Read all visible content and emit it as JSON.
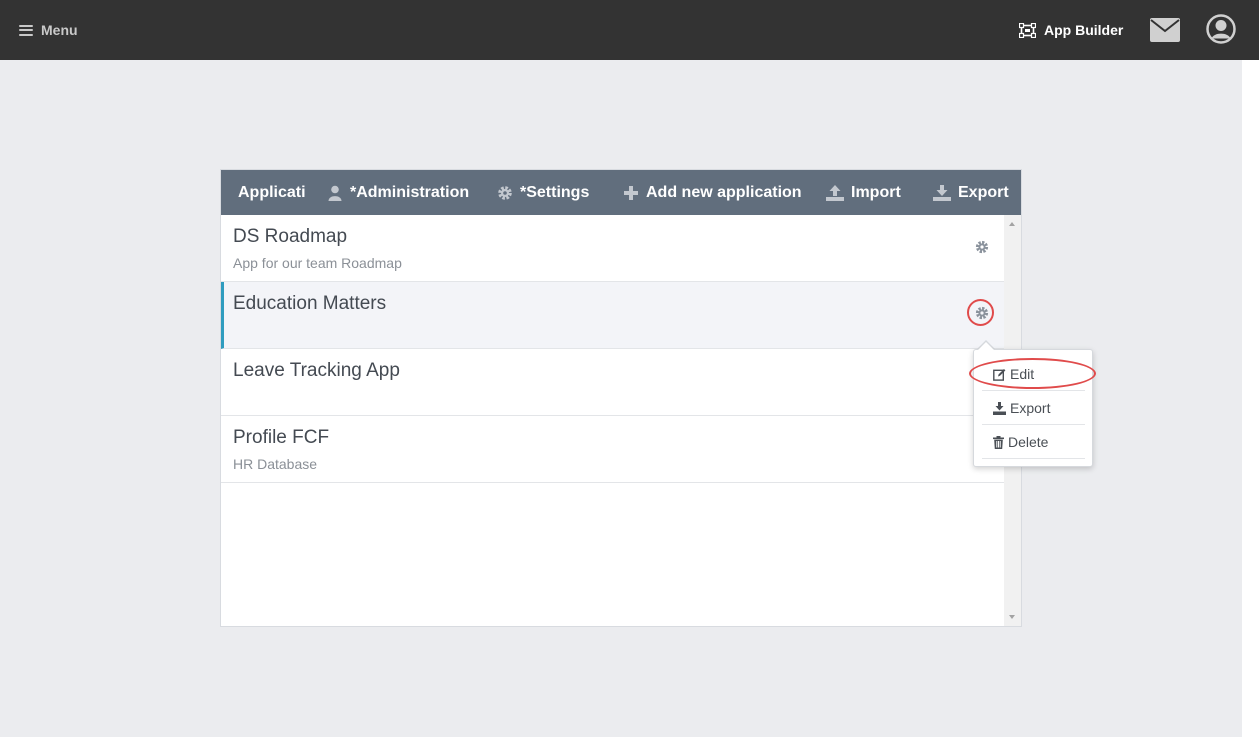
{
  "topbar": {
    "menu_label": "Menu",
    "app_builder_label": "App Builder",
    "icons": {
      "menu": "hamburger-icon",
      "app_builder": "app-builder-icon",
      "mail": "envelope-icon",
      "user": "user-circle-icon"
    }
  },
  "panel": {
    "title": "Applications",
    "actions": [
      {
        "label": "*Administration",
        "icon": "user-icon"
      },
      {
        "label": "*Settings",
        "icon": "gear-icon"
      },
      {
        "label": "Add new application",
        "icon": "plus-icon"
      },
      {
        "label": "Import",
        "icon": "upload-icon"
      },
      {
        "label": "Export",
        "icon": "download-icon"
      }
    ],
    "applications": [
      {
        "name": "DS Roadmap",
        "description": "App for our team Roadmap"
      },
      {
        "name": "Education Matters",
        "description": ""
      },
      {
        "name": "Leave Tracking App",
        "description": ""
      },
      {
        "name": "Profile FCF",
        "description": "HR Database"
      }
    ],
    "active_index": 1
  },
  "dropdown": {
    "items": [
      {
        "label": "Edit",
        "icon": "edit-icon"
      },
      {
        "label": "Export",
        "icon": "download-icon"
      },
      {
        "label": "Delete",
        "icon": "trash-icon"
      }
    ]
  },
  "colors": {
    "topbar_bg": "#333333",
    "header_bg": "#616e7d",
    "active_accent": "#2f9cbf",
    "annotation_red": "#e04b4b",
    "page_bg": "#ebecef"
  }
}
